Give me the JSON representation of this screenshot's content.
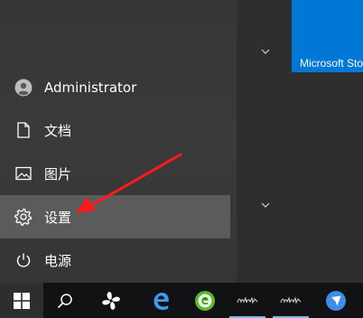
{
  "start_menu": {
    "user": {
      "name": "Administrator",
      "icon": "user-icon"
    },
    "items": [
      {
        "label": "文档",
        "icon": "document-icon"
      },
      {
        "label": "图片",
        "icon": "pictures-icon"
      },
      {
        "label": "设置",
        "icon": "gear-icon",
        "selected": true
      },
      {
        "label": "电源",
        "icon": "power-icon"
      }
    ]
  },
  "tiles": {
    "store_label": "Microsoft Sto",
    "accent_color": "#0078d7"
  },
  "taskbar": {
    "buttons": [
      {
        "icon": "windows-start-icon"
      },
      {
        "icon": "search-icon"
      },
      {
        "icon": "task-view-icon"
      },
      {
        "icon": "edge-browser-icon"
      },
      {
        "icon": "green-app-icon"
      },
      {
        "icon": "app-icon"
      },
      {
        "icon": "app-icon"
      },
      {
        "icon": "blue-app-icon"
      }
    ]
  },
  "annotation": {
    "arrow_color": "#ff1a1a"
  }
}
